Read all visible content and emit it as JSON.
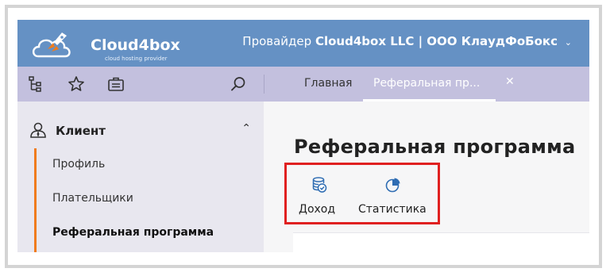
{
  "header": {
    "logo_name": "Cloud4box",
    "logo_tagline": "cloud hosting provider",
    "provider_prefix": "Провайдер",
    "provider_name": "Cloud4box LLC | ООО КлаудФоБокс"
  },
  "toolbar": {
    "icons": [
      "hierarchy-icon",
      "star-icon",
      "briefcase-icon",
      "search-icon"
    ],
    "tabs": [
      {
        "label": "Главная",
        "active": false
      },
      {
        "label": "Реферальная пр...",
        "active": true
      }
    ]
  },
  "sidebar": {
    "section_label": "Клиент",
    "items": [
      {
        "label": "Профиль",
        "active": false
      },
      {
        "label": "Плательщики",
        "active": false
      },
      {
        "label": "Реферальная программа",
        "active": true
      }
    ]
  },
  "main": {
    "title": "Реферальная программа",
    "actions": [
      {
        "label": "Доход",
        "icon": "coins-icon"
      },
      {
        "label": "Статистика",
        "icon": "pie-chart-icon"
      }
    ]
  },
  "colors": {
    "header_bg": "#6591c4",
    "toolbar_bg": "#c3c0de",
    "accent_orange": "#f07c1d",
    "highlight_red": "#e02020",
    "icon_blue": "#2f6db3"
  }
}
